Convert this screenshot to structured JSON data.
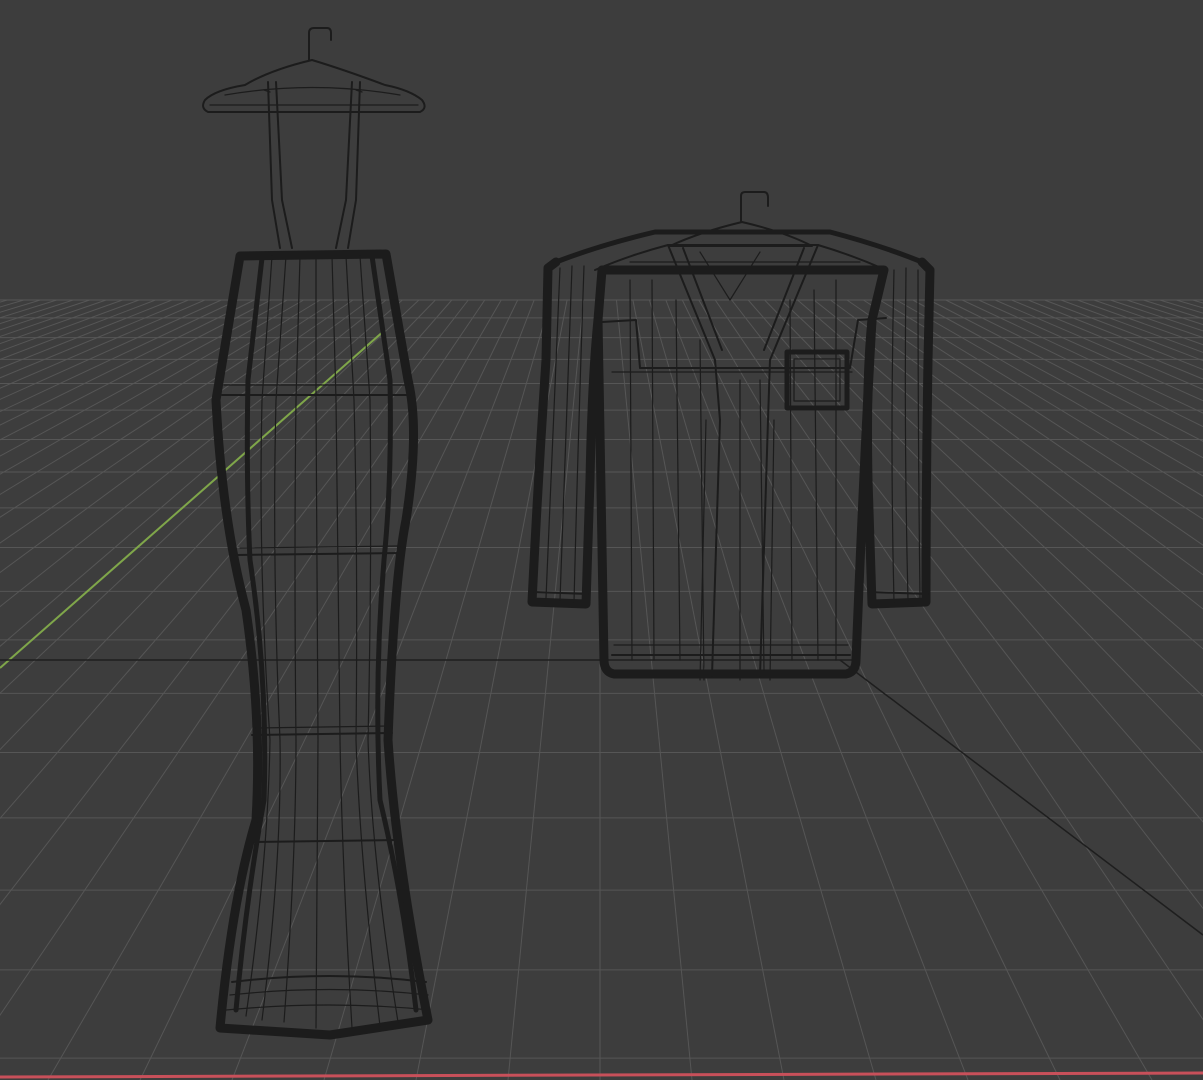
{
  "viewport": {
    "background": "#3d3d3d",
    "grid_color": "#565656",
    "wire_color": "#1c1c1c",
    "axis_y_color": "#7fa64a",
    "axis_x_color": "#c8505a",
    "objects": [
      {
        "name": "dress-on-hanger",
        "display": "wireframe"
      },
      {
        "name": "shirt-on-hanger",
        "display": "wireframe"
      }
    ]
  }
}
